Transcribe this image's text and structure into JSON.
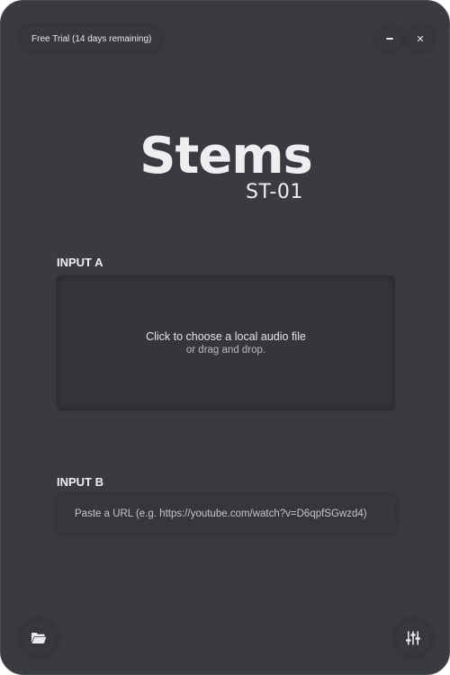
{
  "header": {
    "trial_text": "Free Trial (14 days remaining)",
    "minimize_icon": "minimize-icon",
    "close_icon": "close-icon",
    "close_glyph": "✕"
  },
  "logo": {
    "title": "Stems",
    "model": "ST-01"
  },
  "input_a": {
    "label": "INPUT A",
    "primary_text": "Click to choose a local audio file",
    "secondary_text": "or drag and drop."
  },
  "input_b": {
    "label": "INPUT B",
    "placeholder": "Paste a URL (e.g. https://youtube.com/watch?v=D6qpfSGwzd4)",
    "value": ""
  },
  "footer": {
    "left_icon": "folder-icon",
    "right_icon": "mixer-sliders-icon"
  },
  "colors": {
    "background": "#393b40",
    "text": "#eceef0",
    "panel": "#34363b"
  }
}
